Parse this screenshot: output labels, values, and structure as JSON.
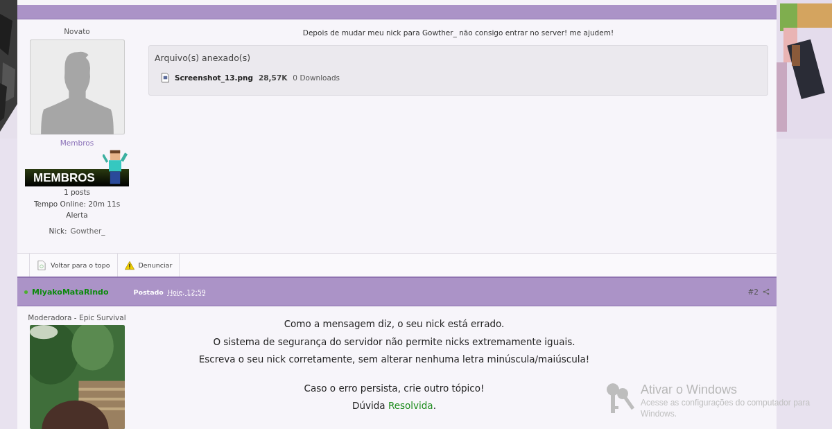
{
  "post1": {
    "rank": "Novato",
    "group": "Membros",
    "badge": "MEMBROS",
    "stats": [
      "1 posts",
      "Tempo Online: 20m 11s",
      "Alerta"
    ],
    "nick_label": "Nick:",
    "nick": "Gowther_",
    "message": "Depois de mudar meu nick para Gowther_ não consigo entrar no server! me ajudem!",
    "attachments": {
      "title": "Arquivo(s) anexado(s)",
      "files": [
        {
          "name": "Screenshot_13.png",
          "size": "28,57K",
          "downloads": "0 Downloads"
        }
      ]
    },
    "actions": [
      {
        "label": "Voltar para o topo",
        "kind": "top"
      },
      {
        "label": "Denunciar",
        "kind": "report"
      }
    ]
  },
  "post2": {
    "online": true,
    "author": "MiyakoMataRindo",
    "posted_label": "Postado",
    "posted_time": "Hoje, 12:59",
    "number": "#2",
    "rank": "Moderadora - Epic Survival",
    "lines": [
      "Como a mensagem diz, o seu nick está errado.",
      "O sistema de segurança do servidor não permite nicks extremamente iguais.",
      "Escreva o seu nick corretamente, sem alterar nenhuma letra minúscula/maiúscula!"
    ],
    "closing": "Caso o erro persista, crie outro tópico!",
    "status": {
      "prefix": "Dúvida",
      "highlight": "Resolvida",
      "suffix": "."
    }
  },
  "windows_notice": {
    "title": "Ativar o Windows",
    "lines": [
      "Acesse as configurações do computador para",
      "Windows."
    ]
  }
}
